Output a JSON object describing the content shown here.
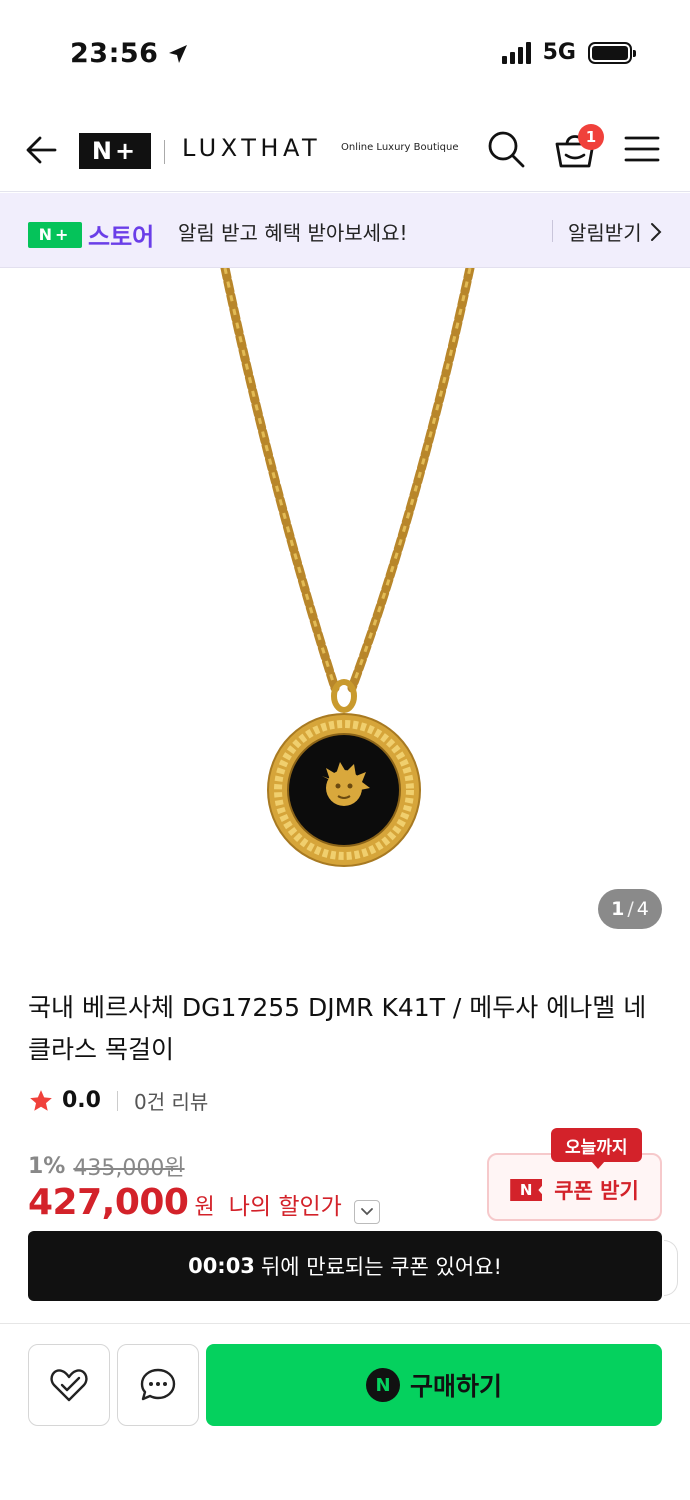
{
  "status_bar": {
    "time": "23:56",
    "network": "5G"
  },
  "header": {
    "logo": "N+",
    "brand": "LUXTHAT",
    "brand_subtitle": "Online Luxury Boutique",
    "cart_count": "1"
  },
  "store_bar": {
    "logo": "N+",
    "store_name": "스토어",
    "message": "알림 받고 혜택 받아보세요!",
    "alarm_label": "알림받기"
  },
  "gallery": {
    "current": "1",
    "separator": "/",
    "total": "4"
  },
  "product": {
    "title": "국내 베르사체 DG17255 DJMR K41T / 메두사 에나멜 네클라스 목걸이",
    "rating": "0.0",
    "review_count": "0건 리뷰",
    "discount_rate": "1%",
    "original_price": "435,000원",
    "sale_price": "427,000",
    "sale_unit": "원",
    "my_price_label": "나의 할인가"
  },
  "coupon": {
    "today_label": "오늘까지",
    "n_mark": "N",
    "button_label": "쿠폰 받기"
  },
  "expire_banner": {
    "time": "00:03",
    "message": "뒤에 만료되는 쿠폰 있어요!"
  },
  "bottom_bar": {
    "buy_mark": "N",
    "buy_label": "구매하기"
  },
  "colors": {
    "naver_green": "#05d15e",
    "sale_red": "#d3222a",
    "store_purple": "#6a3ee8",
    "store_bar_bg": "#f1eefc",
    "badge_red": "#f0413b",
    "gold": "#c99a2e"
  },
  "icons": {
    "back": "arrow-left-icon",
    "search": "search-icon",
    "cart": "shopping-basket-icon",
    "menu": "hamburger-menu-icon",
    "alarm_chevron": "chevron-right-icon",
    "star": "star-icon",
    "toggle": "chevron-down-icon",
    "wish": "heart-check-icon",
    "chat": "chat-bubble-icon"
  }
}
